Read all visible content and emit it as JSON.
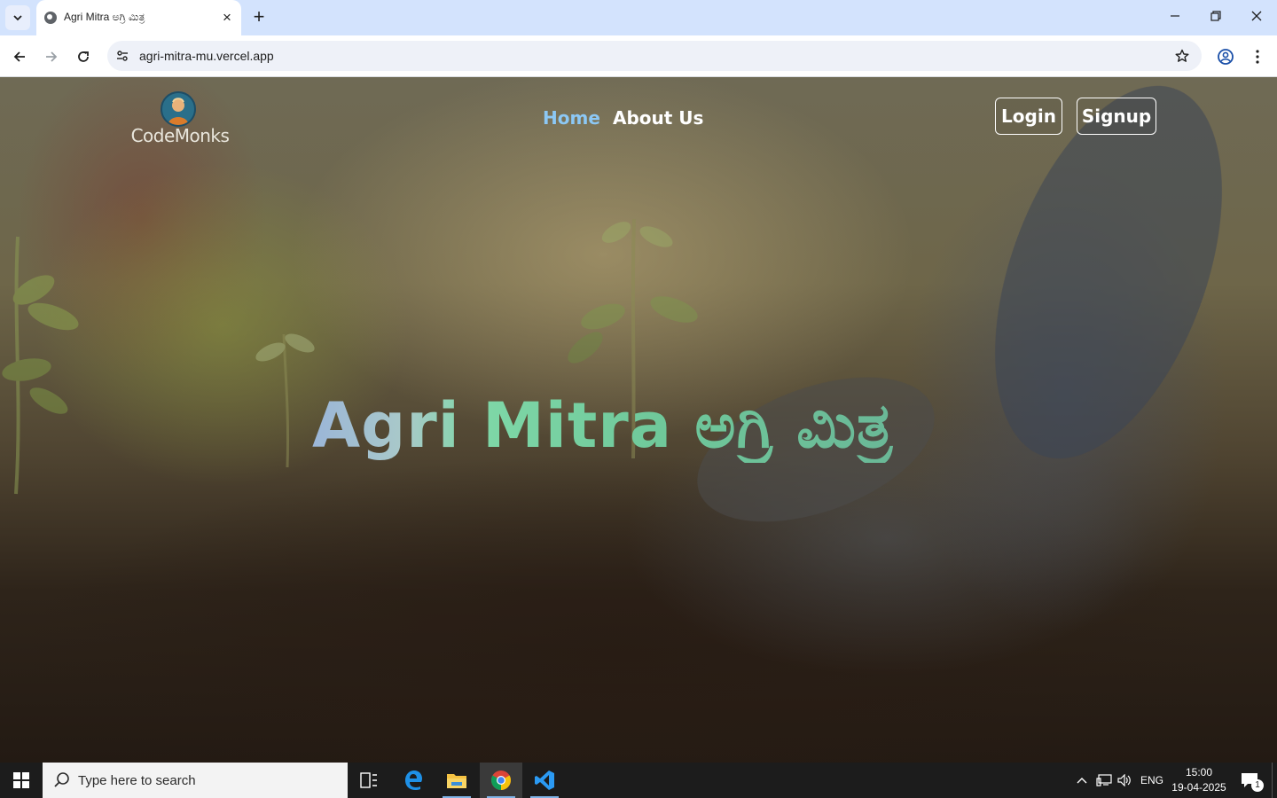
{
  "browser": {
    "tab_title": "Agri Mitra ಅಗ್ರಿ ಮಿತ್ರ",
    "url": "agri-mitra-mu.vercel.app"
  },
  "site": {
    "logo_text": "CodeMonks",
    "nav": [
      {
        "label": "Home",
        "active": true,
        "color": "#8cc8f5"
      },
      {
        "label": "About Us",
        "active": false,
        "color": "#ffffff"
      }
    ],
    "login_label": "Login",
    "signup_label": "Signup",
    "hero_title": "Agri Mitra ಅಗ್ರಿ ಮಿತ್ರ"
  },
  "taskbar": {
    "search_placeholder": "Type here to search",
    "language": "ENG",
    "time": "15:00",
    "date": "19-04-2025",
    "notification_count": "1",
    "apps": [
      "task-view",
      "edge",
      "file-explorer",
      "chrome",
      "vscode"
    ]
  }
}
